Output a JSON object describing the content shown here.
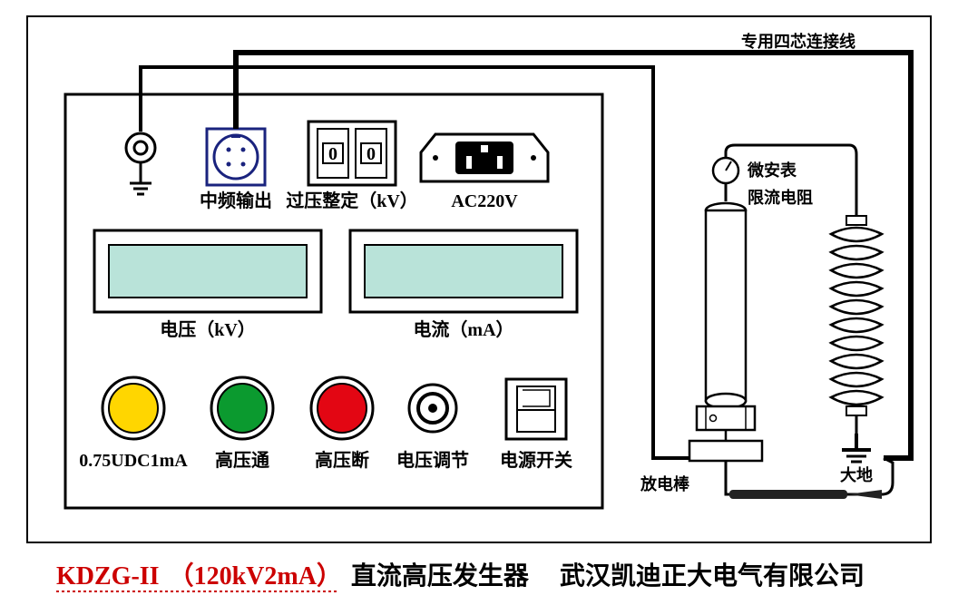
{
  "panel": {
    "outputLabel": "中频输出",
    "ovpLabel": "过压整定（kV）",
    "acLabel": "AC220V",
    "voltageLabel": "电压（kV）",
    "currentLabel": "电流（mA）",
    "yellowBtn": "0.75UDC1mA",
    "greenBtn": "高压通",
    "redBtn": "高压断",
    "adjust": "电压调节",
    "power": "电源开关",
    "switchDigit": "0"
  },
  "wiring": {
    "cable": "专用四芯连接线",
    "microAmp": "微安表",
    "limiter": "限流电阻",
    "rod": "放电棒",
    "ground": "大地"
  },
  "caption": {
    "model": "KDZG-II",
    "spec": "（120kV2mA）",
    "name": "直流高压发生器",
    "company": "武汉凯迪正大电气有限公司"
  }
}
